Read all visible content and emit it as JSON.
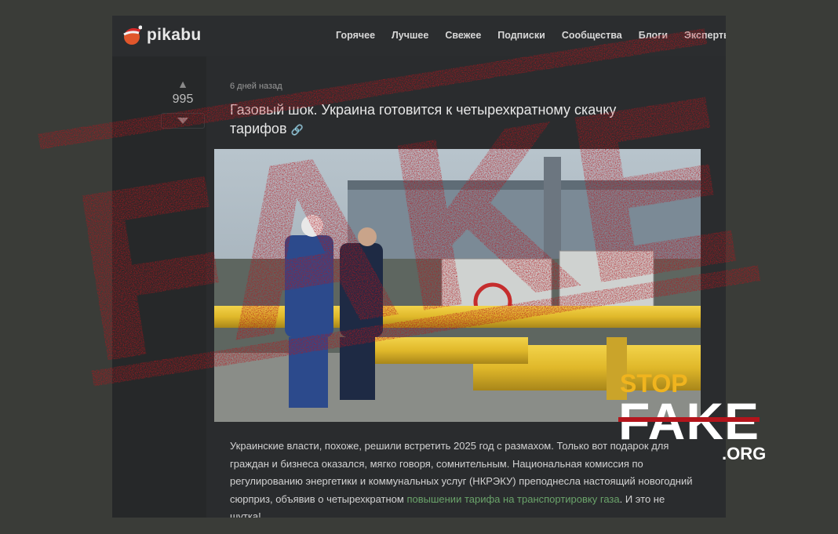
{
  "site": {
    "logo_text": "pikabu",
    "logo_icon": "santa-hat-ball-icon"
  },
  "nav": [
    "Горячее",
    "Лучшее",
    "Свежее",
    "Подписки",
    "Сообщества",
    "Блоги",
    "Эксперты"
  ],
  "post": {
    "votes": "995",
    "meta": "6 дней назад",
    "title": "Газовый шок. Украина готовится к четырехкратному скачку тарифов",
    "link_icon": "link-icon",
    "body_before": "Украинские власти, похоже, решили встретить 2025 год с размахом. Только вот подарок для граждан и бизнеса оказался, мягко говоря, сомнительным. Национальная комиссия по регулированию энергетики и коммунальных услуг (НКРЭКУ) преподнесла настоящий новогодний сюрприз, объявив о четырехкратном ",
    "body_link": "повышении тарифа на транспортировку газа",
    "body_after": ". И это не шутка!"
  },
  "stamp": {
    "text": "FAKE",
    "color": "#b4151c"
  },
  "watermark": {
    "line1": "STOP",
    "line2": "FAKE",
    "line3": ".ORG",
    "accent": "#f0b41e"
  }
}
